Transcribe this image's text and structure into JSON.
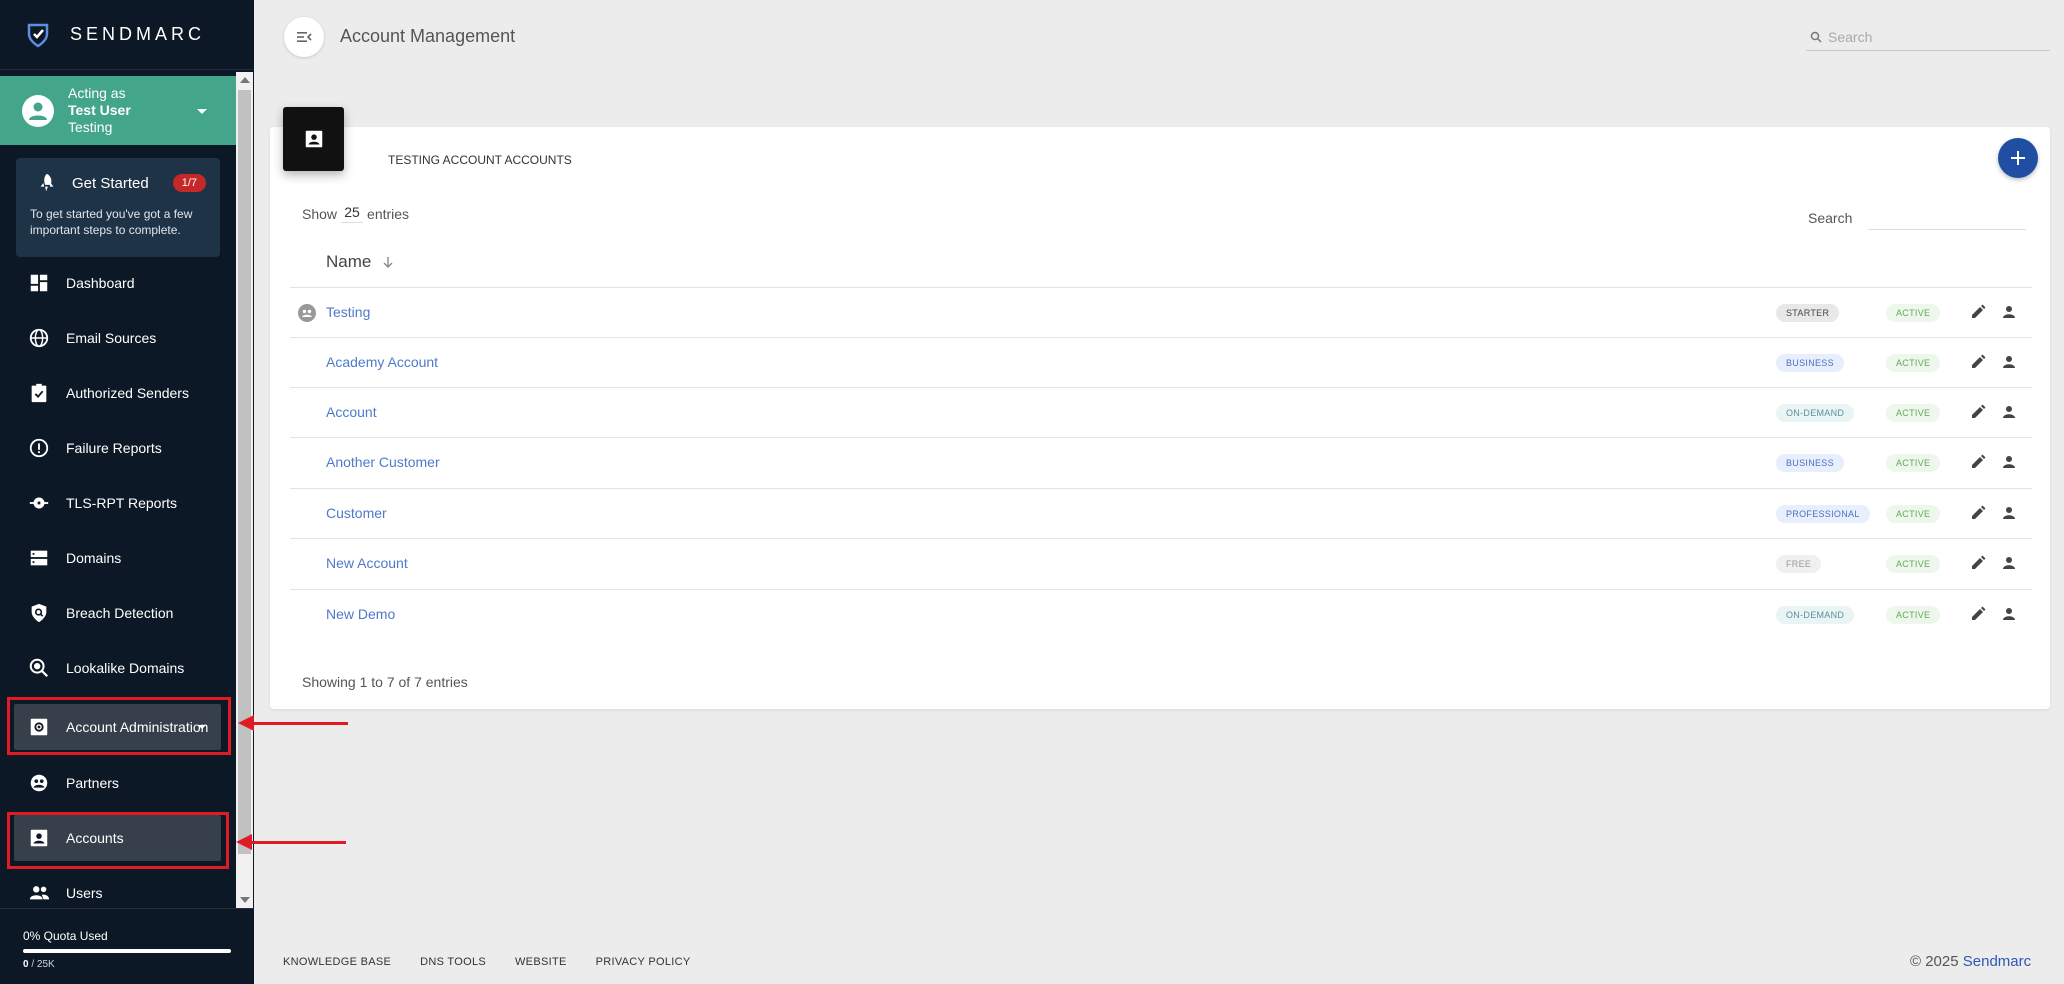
{
  "app": {
    "brand": "SENDMARC",
    "page_title": "Account Management"
  },
  "acting_as": {
    "label": "Acting as",
    "user": "Test User",
    "account": "Testing"
  },
  "get_started": {
    "title": "Get Started",
    "badge": "1/7",
    "description": "To get started you've got a few important steps to complete."
  },
  "sidebar": {
    "items": [
      {
        "label": "Dashboard",
        "icon": "dashboard-icon"
      },
      {
        "label": "Email Sources",
        "icon": "globe-icon"
      },
      {
        "label": "Authorized Senders",
        "icon": "clipboard-check-icon"
      },
      {
        "label": "Failure Reports",
        "icon": "alert-circle-icon"
      },
      {
        "label": "TLS-RPT Reports",
        "icon": "lock-report-icon"
      },
      {
        "label": "Domains",
        "icon": "server-icon"
      },
      {
        "label": "Breach Detection",
        "icon": "shield-search-icon"
      },
      {
        "label": "Lookalike Domains",
        "icon": "magnify-globe-icon"
      },
      {
        "label": "Account Administration",
        "icon": "admin-settings-icon"
      },
      {
        "label": "Partners",
        "icon": "partners-icon"
      },
      {
        "label": "Accounts",
        "icon": "account-box-icon"
      },
      {
        "label": "Users",
        "icon": "users-icon"
      }
    ]
  },
  "quota": {
    "label": "0% Quota Used",
    "used": "0",
    "total": " / 25K",
    "percent": 0
  },
  "search": {
    "placeholder": "Search"
  },
  "card": {
    "title": "TESTING ACCOUNT ACCOUNTS",
    "show_prefix": "Show",
    "show_count": "25",
    "show_suffix": "entries",
    "search_label": "Search",
    "column_name": "Name",
    "showing_text": "Showing 1 to 7 of 7 entries"
  },
  "accounts": [
    {
      "name": "Testing",
      "plan": "STARTER",
      "status": "ACTIVE"
    },
    {
      "name": "Academy Account",
      "plan": "BUSINESS",
      "status": "ACTIVE"
    },
    {
      "name": "Account",
      "plan": "ON-DEMAND",
      "status": "ACTIVE"
    },
    {
      "name": "Another Customer",
      "plan": "BUSINESS",
      "status": "ACTIVE"
    },
    {
      "name": "Customer",
      "plan": "PROFESSIONAL",
      "status": "ACTIVE"
    },
    {
      "name": "New Account",
      "plan": "FREE",
      "status": "ACTIVE"
    },
    {
      "name": "New Demo",
      "plan": "ON-DEMAND",
      "status": "ACTIVE"
    }
  ],
  "footer": {
    "links": [
      "KNOWLEDGE BASE",
      "DNS TOOLS",
      "WEBSITE",
      "PRIVACY POLICY"
    ],
    "copyright": "© 2025 ",
    "copyright_brand": "Sendmarc"
  },
  "colors": {
    "sidebar_bg": "#0c1826",
    "acting_bg": "#43a58a",
    "accent": "#1f4ea3",
    "highlight": "#e01b24",
    "link": "#4f7ac9"
  }
}
